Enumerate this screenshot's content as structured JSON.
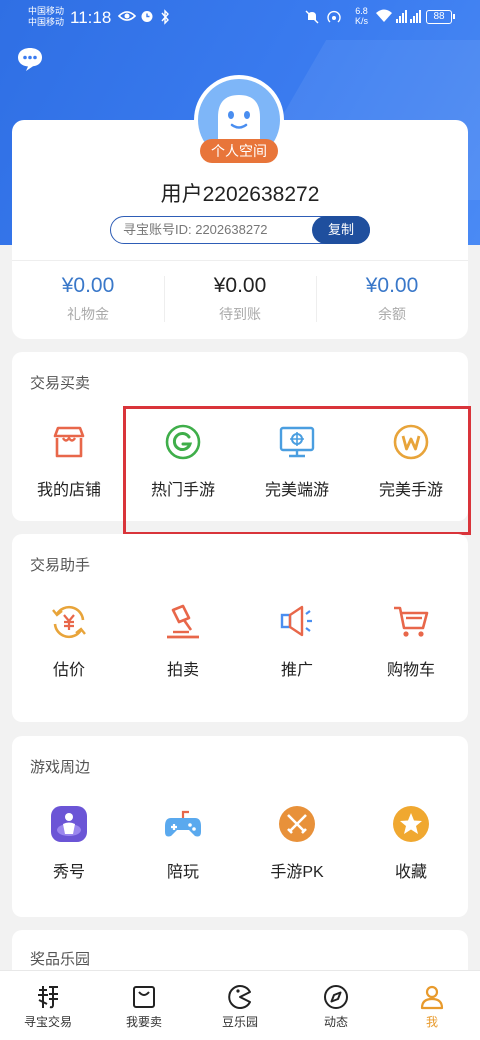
{
  "status_bar": {
    "carrier1": "中国移动",
    "carrier2": "中国移动",
    "time": "11:18",
    "speed_val": "6.8",
    "speed_unit": "K/s",
    "battery": "88"
  },
  "profile": {
    "badge": "个人空间",
    "username": "用户2202638272",
    "id_label": "寻宝账号ID:  2202638272",
    "copy_label": "复制"
  },
  "balances": [
    {
      "value": "¥0.00",
      "label": "礼物金",
      "color": "#3a78c9"
    },
    {
      "value": "¥0.00",
      "label": "待到账",
      "color": "#222222"
    },
    {
      "value": "¥0.00",
      "label": "余额",
      "color": "#3a78c9"
    }
  ],
  "sections": {
    "trade": {
      "title": "交易买卖",
      "items": [
        {
          "label": "我的店铺",
          "icon": "shop-icon"
        },
        {
          "label": "热门手游",
          "icon": "hot-mobile-game-icon"
        },
        {
          "label": "完美端游",
          "icon": "pc-game-icon"
        },
        {
          "label": "完美手游",
          "icon": "perfect-mobile-game-icon"
        }
      ]
    },
    "assistant": {
      "title": "交易助手",
      "items": [
        {
          "label": "估价",
          "icon": "valuation-icon"
        },
        {
          "label": "拍卖",
          "icon": "auction-icon"
        },
        {
          "label": "推广",
          "icon": "megaphone-icon"
        },
        {
          "label": "购物车",
          "icon": "cart-icon"
        }
      ]
    },
    "game": {
      "title": "游戏周边",
      "items": [
        {
          "label": "秀号",
          "icon": "showcase-icon"
        },
        {
          "label": "陪玩",
          "icon": "gamepad-icon"
        },
        {
          "label": "手游PK",
          "icon": "swords-icon"
        },
        {
          "label": "收藏",
          "icon": "star-icon"
        }
      ]
    },
    "prize": {
      "title": "奖品乐园"
    }
  },
  "bottom_nav": [
    {
      "label": "寻宝交易",
      "icon": "treasure-trade-icon",
      "active": false
    },
    {
      "label": "我要卖",
      "icon": "sell-bag-icon",
      "active": false
    },
    {
      "label": "豆乐园",
      "icon": "bean-park-icon",
      "active": false
    },
    {
      "label": "动态",
      "icon": "compass-icon",
      "active": false
    },
    {
      "label": "我",
      "icon": "profile-icon",
      "active": true
    }
  ],
  "colors": {
    "brand_blue": "#3b7cf0",
    "accent_orange": "#e89a2c",
    "highlight_red": "#d9343a"
  }
}
